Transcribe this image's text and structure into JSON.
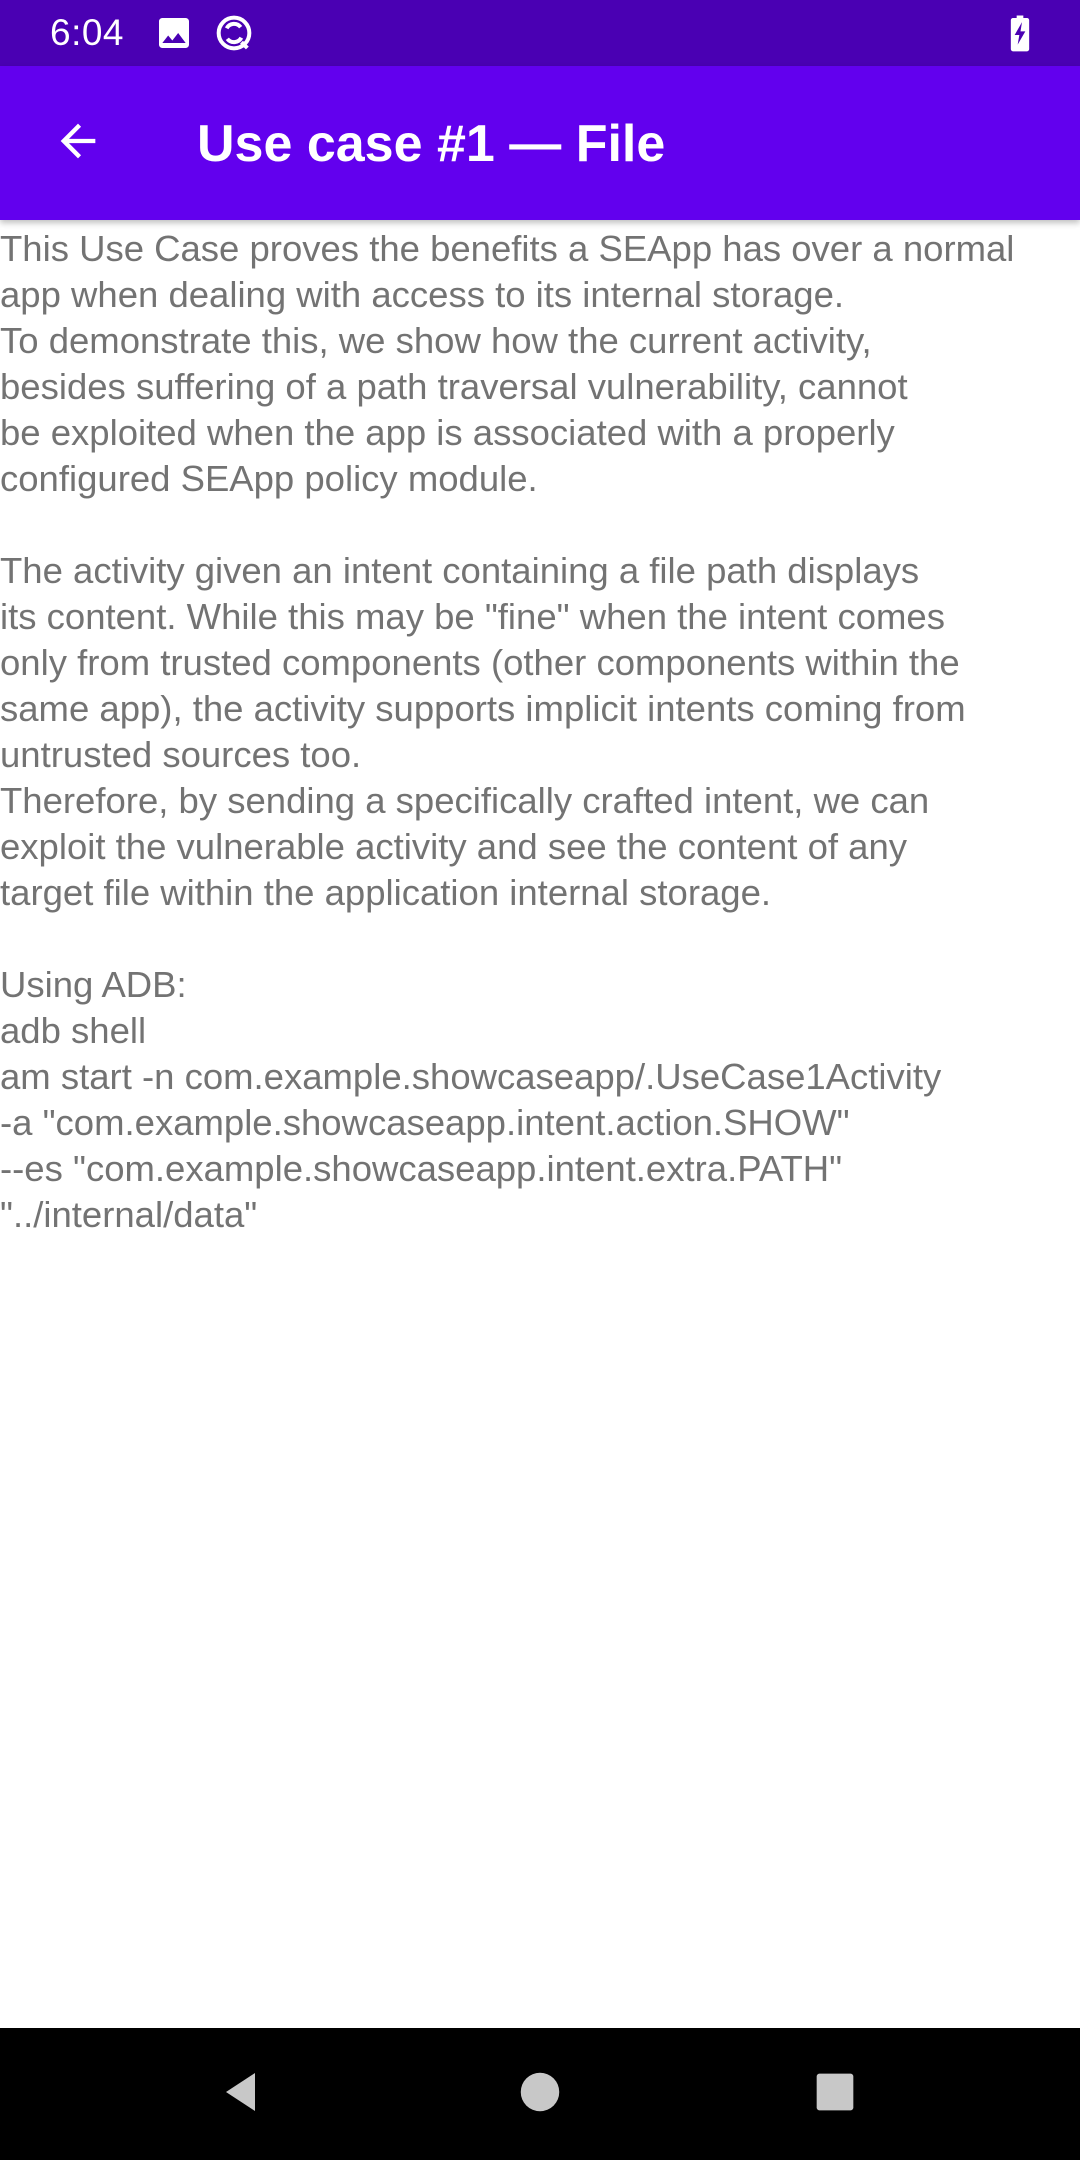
{
  "status_bar": {
    "time": "6:04",
    "icons": [
      "image-icon",
      "sync-icon",
      "battery-charging-icon"
    ]
  },
  "app_bar": {
    "title": "Use case #1 — File",
    "back_icon": "arrow-back-icon"
  },
  "content": {
    "paragraphs": [
      {
        "lines": [
          "This Use Case proves the benefits a SEApp has over a normal",
          "app when dealing with access to its internal storage.",
          "To demonstrate this, we show how the current activity,",
          "besides suffering of a path traversal vulnerability, cannot",
          "be exploited when the app is associated with a properly",
          "configured SEApp policy module."
        ]
      },
      {
        "lines": [
          "The activity given an intent containing a file path displays",
          "its content. While this may be \"fine\" when the intent comes",
          "only from trusted components (other components within the",
          "same app), the activity supports implicit intents coming from",
          "untrusted sources too.",
          "Therefore, by sending a specifically crafted intent, we can",
          "exploit the vulnerable activity and see the content of any",
          "target file within the application internal storage."
        ]
      },
      {
        "lines": [
          "Using ADB:",
          "adb shell",
          "am start -n com.example.showcaseapp/.UseCase1Activity",
          "-a \"com.example.showcaseapp.intent.action.SHOW\"",
          "--es \"com.example.showcaseapp.intent.extra.PATH\"",
          "\"../internal/data\""
        ]
      }
    ]
  },
  "nav_bar": {
    "buttons": [
      "back-triangle-icon",
      "home-circle-icon",
      "recents-square-icon"
    ]
  },
  "colors": {
    "status_bar": "#4a00b3",
    "app_bar": "#6200ee",
    "body_text": "#737373",
    "nav_bar": "#000000"
  }
}
